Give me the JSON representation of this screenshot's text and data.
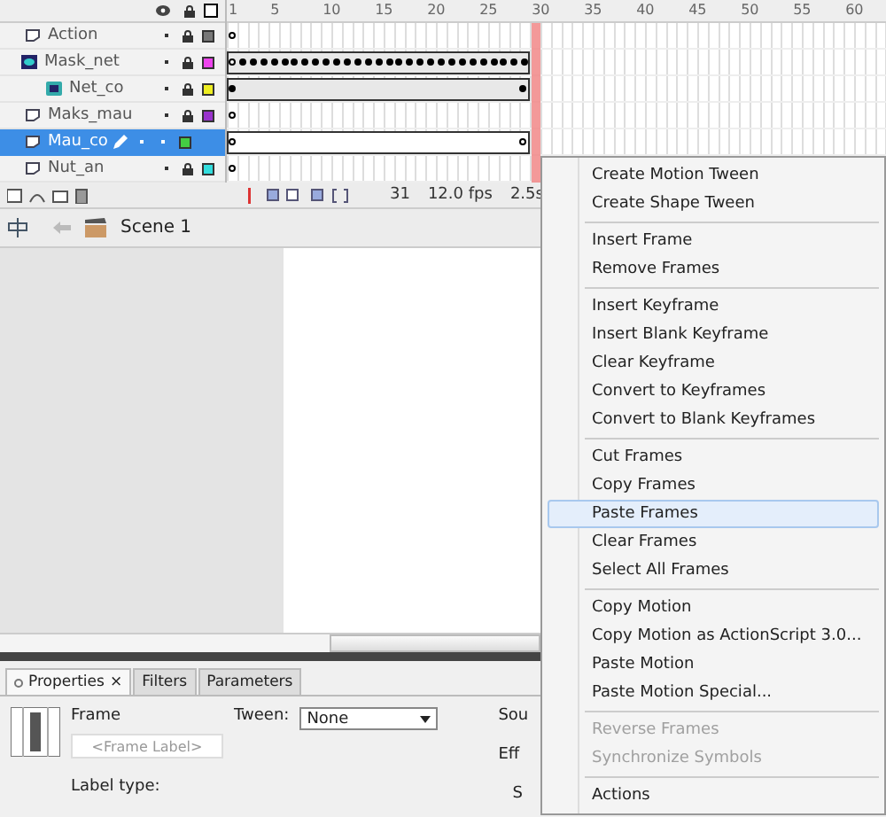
{
  "timeline": {
    "ruler": [
      "1",
      "5",
      "10",
      "15",
      "20",
      "25",
      "30",
      "35",
      "40",
      "45",
      "50",
      "55",
      "60"
    ],
    "layers": [
      {
        "name": "Action",
        "kind": "normal",
        "color": "#777777",
        "locked": true,
        "selected": false,
        "track": {
          "kind": "empty"
        }
      },
      {
        "name": "Mask_net",
        "kind": "mask",
        "color": "#ee44ee",
        "locked": true,
        "selected": false,
        "track": {
          "kind": "keyframe-run"
        }
      },
      {
        "name": "Net_co",
        "kind": "masked",
        "color": "#eeee22",
        "locked": true,
        "selected": false,
        "track": {
          "kind": "span"
        }
      },
      {
        "name": "Maks_mau",
        "kind": "normal",
        "color": "#9933cc",
        "locked": true,
        "selected": false,
        "track": {
          "kind": "empty"
        }
      },
      {
        "name": "Mau_co",
        "kind": "normal",
        "color": "#44cc44",
        "locked": false,
        "selected": true,
        "track": {
          "kind": "blank-span"
        }
      },
      {
        "name": "Nut_an",
        "kind": "normal",
        "color": "#33dddd",
        "locked": true,
        "selected": false,
        "track": {
          "kind": "empty"
        }
      }
    ],
    "status": {
      "frame": "31",
      "fps": "12.0 fps",
      "time": "2.5s"
    }
  },
  "scene": {
    "name": "Scene 1"
  },
  "properties": {
    "tabs": [
      {
        "label": "Properties",
        "selected": true
      },
      {
        "label": "Filters",
        "selected": false
      },
      {
        "label": "Parameters",
        "selected": false
      }
    ],
    "close": "×",
    "frame_title": "Frame",
    "label_placeholder": "<Frame Label>",
    "tween_label": "Tween:",
    "tween_value": "None",
    "label_type": "Label type:",
    "cut_labels": [
      "Sou",
      "Eff",
      "S"
    ]
  },
  "context_menu": [
    [
      {
        "label": "Create Motion Tween",
        "disabled": false,
        "selected": false
      },
      {
        "label": "Create Shape Tween",
        "disabled": false,
        "selected": false
      }
    ],
    [
      {
        "label": "Insert Frame",
        "disabled": false,
        "selected": false
      },
      {
        "label": "Remove Frames",
        "disabled": false,
        "selected": false
      }
    ],
    [
      {
        "label": "Insert Keyframe",
        "disabled": false,
        "selected": false
      },
      {
        "label": "Insert Blank Keyframe",
        "disabled": false,
        "selected": false
      },
      {
        "label": "Clear Keyframe",
        "disabled": false,
        "selected": false
      },
      {
        "label": "Convert to Keyframes",
        "disabled": false,
        "selected": false
      },
      {
        "label": "Convert to Blank Keyframes",
        "disabled": false,
        "selected": false
      }
    ],
    [
      {
        "label": "Cut Frames",
        "disabled": false,
        "selected": false
      },
      {
        "label": "Copy Frames",
        "disabled": false,
        "selected": false
      },
      {
        "label": "Paste Frames",
        "disabled": false,
        "selected": true
      },
      {
        "label": "Clear Frames",
        "disabled": false,
        "selected": false
      },
      {
        "label": "Select All Frames",
        "disabled": false,
        "selected": false
      }
    ],
    [
      {
        "label": "Copy Motion",
        "disabled": false,
        "selected": false
      },
      {
        "label": "Copy Motion as ActionScript 3.0...",
        "disabled": false,
        "selected": false
      },
      {
        "label": "Paste Motion",
        "disabled": false,
        "selected": false
      },
      {
        "label": "Paste Motion Special...",
        "disabled": false,
        "selected": false
      }
    ],
    [
      {
        "label": "Reverse Frames",
        "disabled": true,
        "selected": false
      },
      {
        "label": "Synchronize Symbols",
        "disabled": true,
        "selected": false
      }
    ],
    [
      {
        "label": "Actions",
        "disabled": false,
        "selected": false
      }
    ]
  ]
}
